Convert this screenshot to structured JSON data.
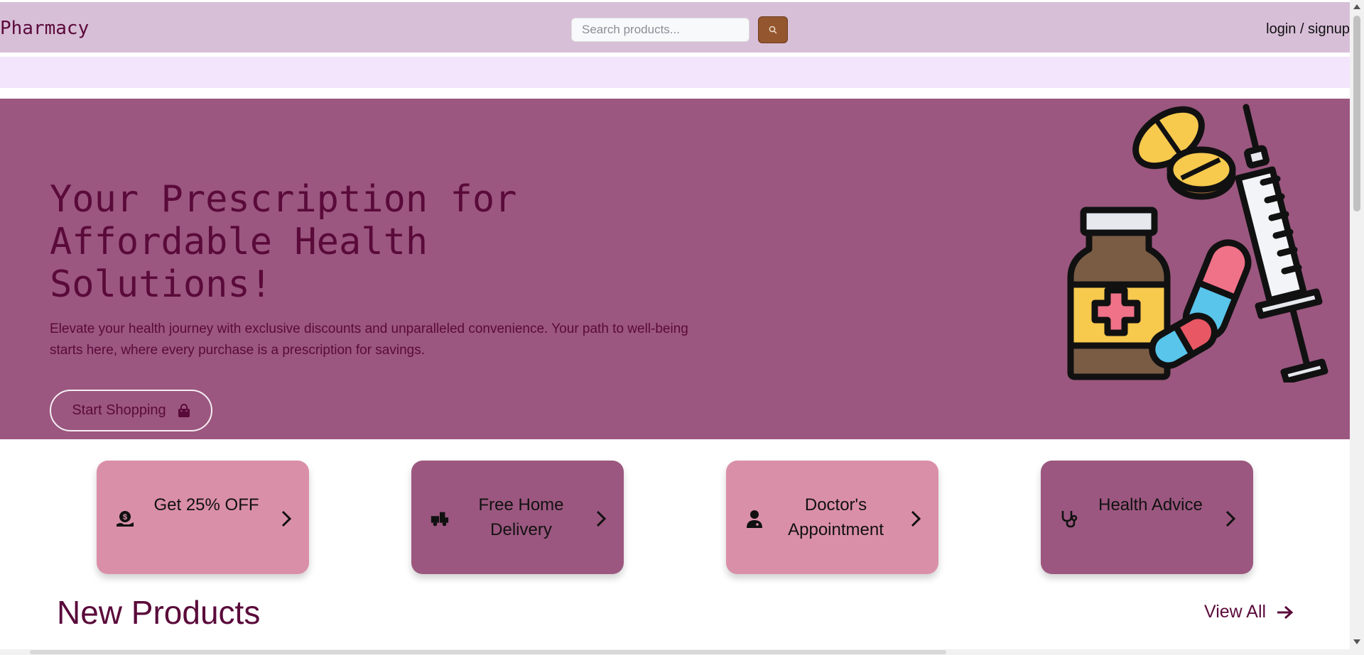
{
  "navbar": {
    "brand": "Pharmacy",
    "search_placeholder": "Search products...",
    "search_icon": "search-icon",
    "auth_link": "login / signup"
  },
  "hero": {
    "title": "Your Prescription for Affordable Health Solutions!",
    "text": "Elevate your health journey with exclusive discounts and unparalleled convenience. Your path to well-being starts here, where every purchase is a prescription for savings.",
    "cta_label": "Start Shopping",
    "cta_icon": "shopping-bag-icon",
    "background": "#9b577f",
    "text_color": "#5a0a3a"
  },
  "features": [
    {
      "label": "Get 25% OFF",
      "icon": "money-hand-icon",
      "style": "light"
    },
    {
      "label": "Free Home Delivery",
      "icon": "truck-icon",
      "style": "dark"
    },
    {
      "label": "Doctor's Appointment",
      "icon": "doctor-icon",
      "style": "light"
    },
    {
      "label": "Health Advice",
      "icon": "stethoscope-icon",
      "style": "dark"
    }
  ],
  "new_products": {
    "title": "New Products",
    "view_all": "View All"
  },
  "colors": {
    "navbar": "#d8bfd8",
    "subbar": "#f3e5fb",
    "card_light": "#da8fa8",
    "card_dark": "#9b577f",
    "search_button": "#94562e"
  }
}
